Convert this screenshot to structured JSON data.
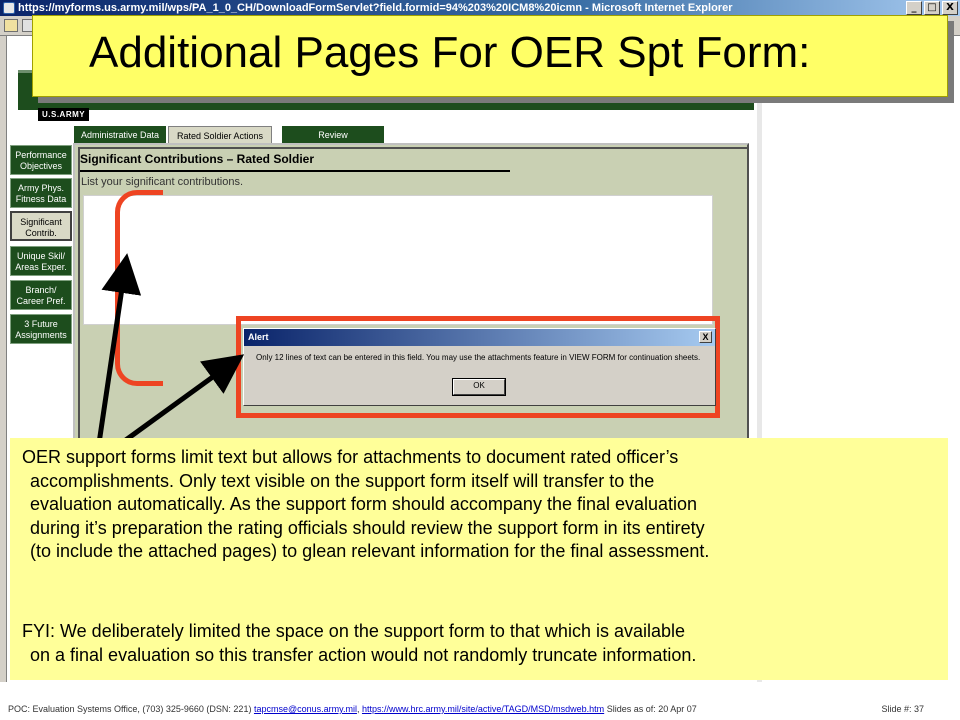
{
  "browser": {
    "window_title": "https://myforms.us.army.mil/wps/PA_1_0_CH/DownloadFormServlet?field.formid=94%203%20ICM8%20icmn - Microsoft Internet Explorer",
    "minimize": "_",
    "maximize": "□",
    "close": "X"
  },
  "slide": {
    "title": "Additional Pages For OER Spt Form:"
  },
  "army_logo": "U.S.ARMY",
  "tabs": [
    {
      "label": "Administrative Data",
      "active": false
    },
    {
      "label": "Rated Soldier Actions",
      "active": true
    },
    {
      "label": "Review",
      "active": false
    }
  ],
  "side_nav": [
    {
      "label_1": "Performance",
      "label_2": "Objectives",
      "active": false
    },
    {
      "label_1": "Army Phys.",
      "label_2": "Fitness Data",
      "active": false
    },
    {
      "label_1": "Significant",
      "label_2": "Contrib.",
      "active": true
    },
    {
      "label_1": "Unique Skil/",
      "label_2": "Areas Exper.",
      "active": false
    },
    {
      "label_1": "Branch/",
      "label_2": "Career Pref.",
      "active": false
    },
    {
      "label_1": "3 Future",
      "label_2": "Assignments",
      "active": false
    }
  ],
  "form": {
    "section_title": "Significant Contributions – Rated Soldier",
    "instruction": "List your significant contributions.",
    "textarea_value": ""
  },
  "alert": {
    "title": "Alert",
    "close": "X",
    "message": "Only 12 lines of text can be entered in this field. You may use the attachments feature in VIEW FORM for continuation sheets.",
    "ok_label": "OK"
  },
  "caption": {
    "p1_lines": [
      "OER support forms limit text but allows for attachments to document rated officer’s",
      "accomplishments.  Only text visible on the support form itself will transfer to the",
      "evaluation automatically.  As the support form should accompany the final evaluation",
      "during it’s preparation the rating officials should review the support form in its entirety",
      "(to include the attached pages) to glean relevant information for the final assessment."
    ],
    "p2_lines": [
      "FYI: We deliberately limited the space on the support form to that which is available",
      "on a final evaluation so this transfer action would not randomly truncate information."
    ]
  },
  "footer": {
    "prefix": "POC: Evaluation Systems Office, (703) 325-9660 (DSN: 221) ",
    "email": "tapcmse@conus.army.mil",
    "separator": ", ",
    "url": "https://www.hrc.army.mil/site/active/TAGD/MSD/msdweb.htm",
    "date_text": "  Slides as of:  20 Apr 07",
    "slide_number": "Slide #: 37"
  },
  "colors": {
    "army_green": "#1d4d1d",
    "highlight_red": "#ee4422",
    "title_yellow": "#ffff66",
    "caption_yellow": "#ffff99"
  }
}
